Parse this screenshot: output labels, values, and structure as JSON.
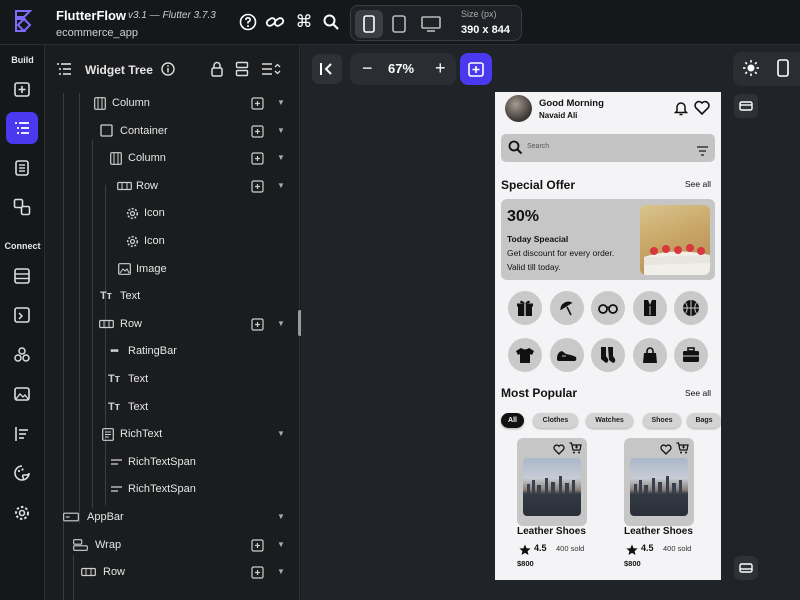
{
  "topbar": {
    "app_name": "FlutterFlow",
    "version": "v3.1 — Flutter 3.7.3",
    "project_name": "ecommerce_app",
    "icons": [
      "help-icon",
      "link-icon",
      "command-icon",
      "search-icon"
    ],
    "devices": [
      "mobile-icon",
      "tablet-icon",
      "desktop-icon"
    ],
    "size_label": "Size (px)",
    "size_value": "390 x 844"
  },
  "rail": {
    "build_label": "Build",
    "connect_label": "Connect",
    "build_items": [
      "add-page-icon",
      "widget-tree-icon",
      "storyboard-icon",
      "components-icon"
    ],
    "connect_items": [
      "database-icon",
      "api-icon",
      "integrations-icon",
      "media-icon",
      "list-icon",
      "theme-icon",
      "settings-icon"
    ]
  },
  "tree": {
    "title": "Widget Tree",
    "rows": [
      {
        "label": "Column",
        "icon": "column-icon"
      },
      {
        "label": "Container",
        "icon": "container-icon"
      },
      {
        "label": "Column",
        "icon": "column-icon"
      },
      {
        "label": "Row",
        "icon": "row-icon"
      },
      {
        "label": "Icon",
        "icon": "gear-icon"
      },
      {
        "label": "Icon",
        "icon": "gear-icon"
      },
      {
        "label": "Image",
        "icon": "image-icon"
      },
      {
        "label": "Text",
        "icon": "text-icon"
      },
      {
        "label": "Row",
        "icon": "row-icon"
      },
      {
        "label": "RatingBar",
        "icon": "rating-icon"
      },
      {
        "label": "Text",
        "icon": "text-icon"
      },
      {
        "label": "Text",
        "icon": "text-icon"
      },
      {
        "label": "RichText",
        "icon": "richtext-icon"
      },
      {
        "label": "RichTextSpan",
        "icon": "span-icon"
      },
      {
        "label": "RichTextSpan",
        "icon": "span-icon"
      },
      {
        "label": "AppBar",
        "icon": "appbar-icon"
      },
      {
        "label": "Wrap",
        "icon": "wrap-icon"
      },
      {
        "label": "Row",
        "icon": "row-icon"
      }
    ]
  },
  "canvas": {
    "zoom": "67%",
    "zoom_minus": "−",
    "zoom_plus": "+"
  },
  "phone": {
    "greeting": "Good Morning",
    "user_name": "Navaid Ali",
    "search_placeholder": "Search",
    "special_offer": "Special Offer",
    "see_all": "See all",
    "offer_percent": "30%",
    "offer_title": "Today Speacial",
    "offer_desc": "Get discount for every order. Valid till today.",
    "categories": [
      "gift-icon",
      "umbrella-icon",
      "glasses-icon",
      "vest-icon",
      "basketball-icon",
      "tshirt-icon",
      "sneaker-icon",
      "socks-icon",
      "handbag-icon",
      "briefcase-icon"
    ],
    "most_popular": "Most Popular",
    "chips": [
      "All",
      "Clothes",
      "Watches",
      "Shoes",
      "Bags"
    ],
    "products": [
      {
        "name": "Leather Shoes",
        "rating": "4.5",
        "sold": "400 sold",
        "price": "$800"
      },
      {
        "name": "Leather Shoes",
        "rating": "4.5",
        "sold": "400 sold",
        "price": "$800"
      }
    ]
  },
  "colors": {
    "accent": "#4b39ef",
    "panel": "#1a1c1e",
    "canvas": "#202327"
  }
}
